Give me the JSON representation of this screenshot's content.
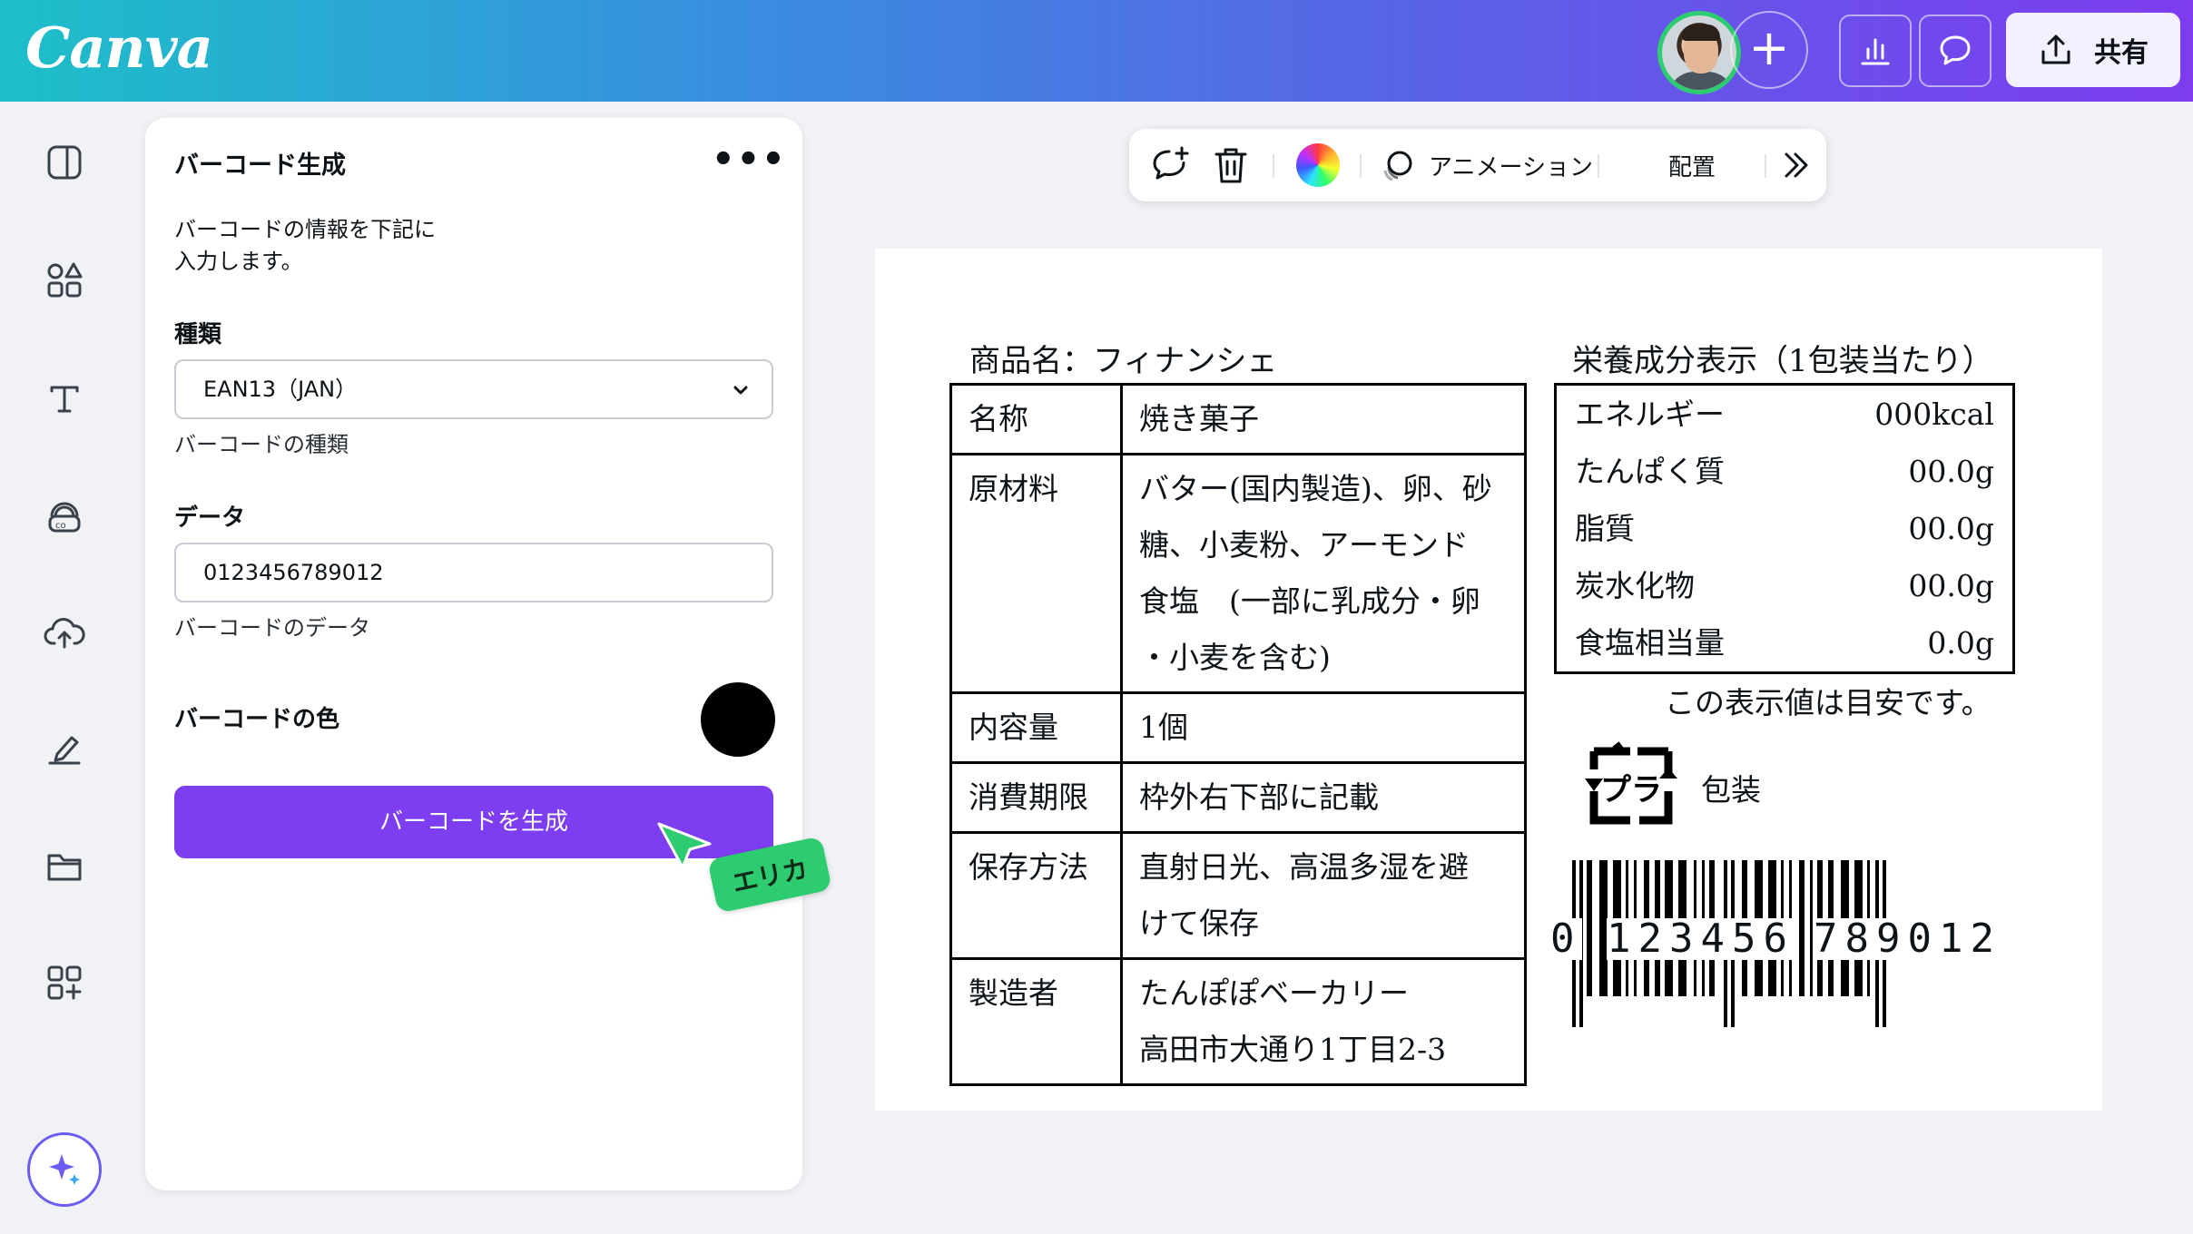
{
  "app": {
    "logo": "Canva"
  },
  "topbar": {
    "share_label": "共有"
  },
  "panel": {
    "title": "バーコード生成",
    "more": "•••",
    "description_line1": "バーコードの情報を下記に",
    "description_line2": "入力します。",
    "type_label": "種類",
    "type_value": "EAN13（JAN）",
    "type_hint": "バーコードの種類",
    "data_label": "データ",
    "data_value": "0123456789012",
    "data_hint": "バーコードのデータ",
    "color_label": "バーコードの色",
    "color_value": "#000000",
    "generate_label": "バーコードを生成"
  },
  "collaborator": {
    "name": "エリカ",
    "color": "#2ecc71"
  },
  "toolbar": {
    "animation_label": "アニメーション",
    "position_label": "配置"
  },
  "label": {
    "product_title": "商品名：フィナンシェ",
    "rows": [
      {
        "key": "名称",
        "lines": [
          "焼き菓子"
        ]
      },
      {
        "key": "原材料",
        "lines": [
          "バター(国内製造)、卵、砂",
          "糖、小麦粉、アーモンド",
          "食塩　(一部に乳成分・卵",
          "・小麦を含む)"
        ]
      },
      {
        "key": "内容量",
        "lines": [
          "1個"
        ]
      },
      {
        "key": "消費期限",
        "lines": [
          "枠外右下部に記載"
        ]
      },
      {
        "key": "保存方法",
        "lines": [
          "直射日光、高温多湿を避",
          "けて保存"
        ]
      },
      {
        "key": "製造者",
        "lines": [
          "たんぽぽベーカリー",
          "高田市大通り1丁目2-3"
        ]
      }
    ],
    "nutrition_title": "栄養成分表示（1包装当たり）",
    "nutrition": [
      {
        "name": "エネルギー",
        "value": "000kcal"
      },
      {
        "name": "たんぱく質",
        "value": "00.0g"
      },
      {
        "name": "脂質",
        "value": "00.0g"
      },
      {
        "name": "炭水化物",
        "value": "00.0g"
      },
      {
        "name": "食塩相当量",
        "value": "0.0g"
      }
    ],
    "nutrition_note": "この表示値は目安です。",
    "recycle_label": "包装",
    "recycle_mark": "プラ",
    "barcode_first": "0",
    "barcode_left": "123456",
    "barcode_right": "789012"
  },
  "colors": {
    "accent": "#7d3df0",
    "collaborator": "#2ecc71"
  },
  "icons": [
    "design-icon",
    "elements-icon",
    "text-icon",
    "brand-icon",
    "uploads-icon",
    "draw-icon",
    "projects-icon",
    "apps-icon",
    "magic-icon"
  ]
}
